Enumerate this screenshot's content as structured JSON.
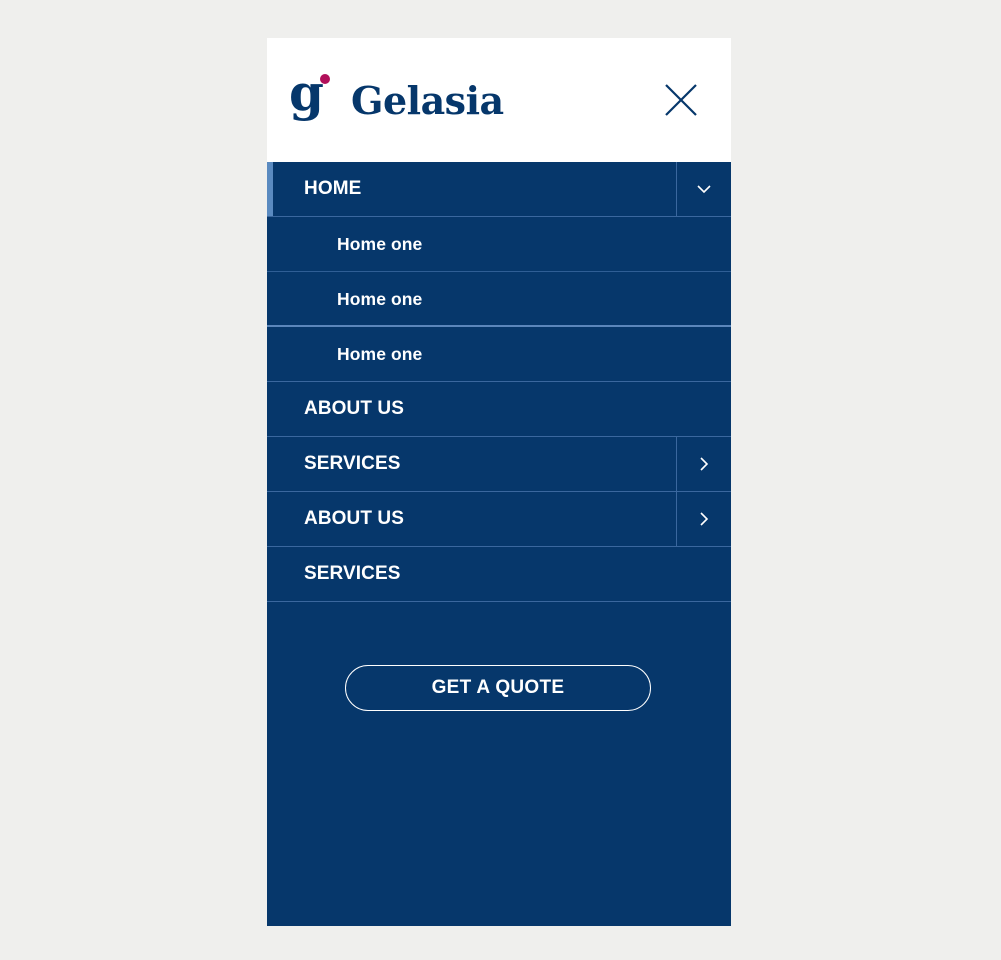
{
  "brand": {
    "name": "Gelasia",
    "logo_icon": "g-logo-icon",
    "primary_color": "#06376b",
    "accent_dot_color": "#b10f5a"
  },
  "header": {
    "close_icon": "close-icon"
  },
  "menu": {
    "items": [
      {
        "label": "HOME",
        "icon": "chevron-down-icon",
        "expanded": true
      },
      {
        "label": "Home one"
      },
      {
        "label": "Home one"
      },
      {
        "label": "Home one"
      },
      {
        "label": "ABOUT US"
      },
      {
        "label": "SERVICES",
        "icon": "chevron-right-icon"
      },
      {
        "label": "ABOUT US",
        "icon": "chevron-right-icon"
      },
      {
        "label": "SERVICES"
      }
    ]
  },
  "cta": {
    "label": "GET A QUOTE"
  },
  "colors": {
    "page_background": "#efefed",
    "panel_background": "#06376b",
    "divider": "#3a679e",
    "active_indicator": "#5a8ac0",
    "text": "#ffffff"
  }
}
